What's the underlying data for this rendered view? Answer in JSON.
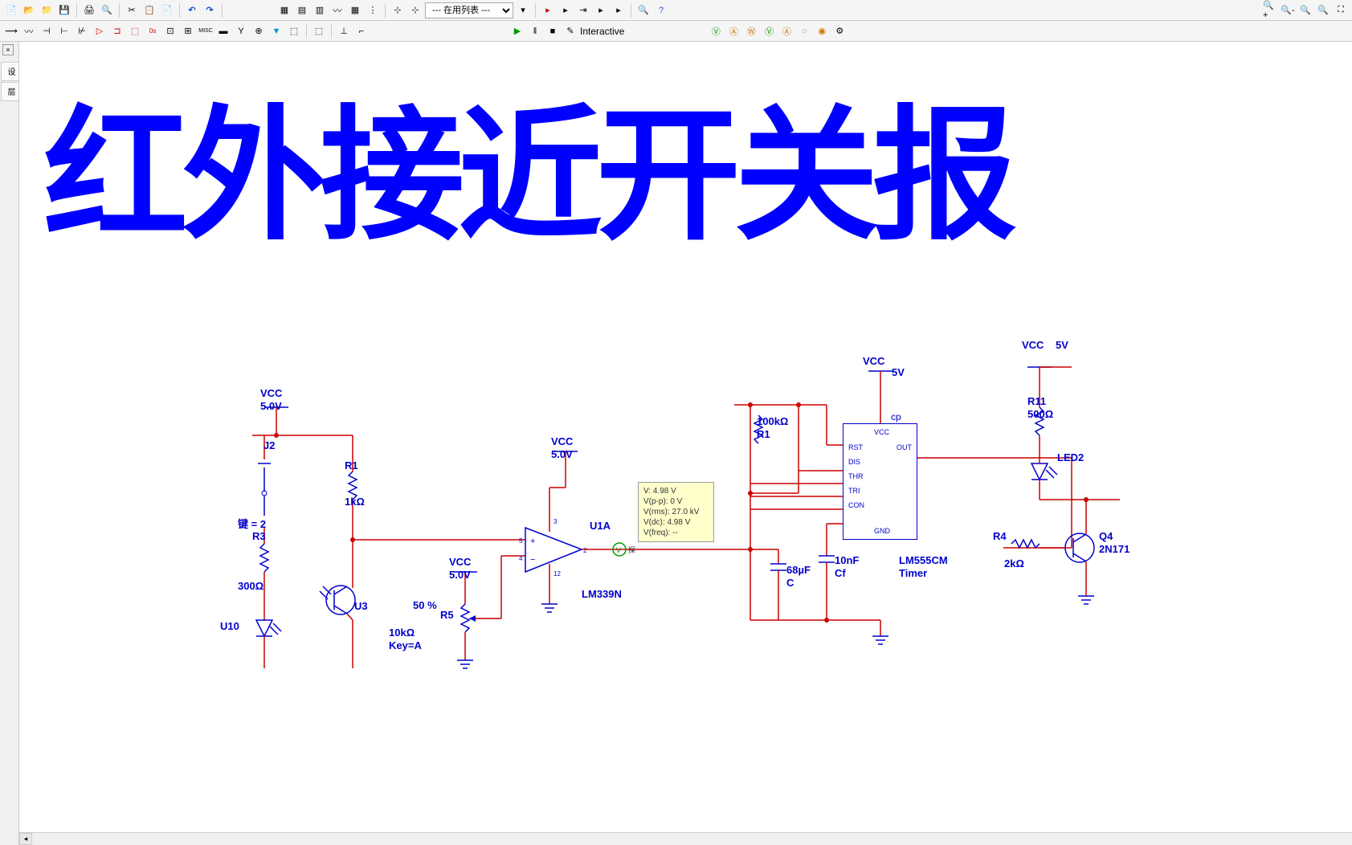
{
  "toolbar": {
    "dropdown_list": "--- 在用列表 ---",
    "interactive_label": "Interactive"
  },
  "title": "红外接近开关报",
  "tooltip": {
    "line1": "V: 4.98 V",
    "line2": "V(p-p): 0 V",
    "line3": "V(rms): 27.0 kV",
    "line4": "V(dc): 4.98 V",
    "line5": "V(freq): --"
  },
  "components": {
    "vcc1": {
      "label": "VCC",
      "value": "5.0V"
    },
    "vcc2": {
      "label": "VCC",
      "value": "5.0V"
    },
    "vcc3": {
      "label": "VCC",
      "value": "5.0V"
    },
    "vcc4": {
      "label": "VCC",
      "value": "5V"
    },
    "vcc5": {
      "label": "VCC",
      "value": "5V"
    },
    "j2": {
      "label": "J2"
    },
    "key2": {
      "label": "键 = 2"
    },
    "r1": {
      "label": "R1",
      "value": "1kΩ"
    },
    "r1b": {
      "label": "R1",
      "value": "100kΩ"
    },
    "r3": {
      "label": "R3",
      "value": "300Ω"
    },
    "r4": {
      "label": "R4",
      "value": "2kΩ"
    },
    "r5": {
      "label": "R5",
      "value": "10kΩ",
      "percent": "50 %",
      "key": "Key=A"
    },
    "r11": {
      "label": "R11",
      "value": "500Ω"
    },
    "u1a": {
      "label": "U1A",
      "value": "LM339N"
    },
    "u3": {
      "label": "U3"
    },
    "u10": {
      "label": "U10"
    },
    "c1": {
      "label": "C",
      "value": "68µF"
    },
    "cf": {
      "label": "Cf",
      "value": "10nF"
    },
    "cp": {
      "label": "cp"
    },
    "timer": {
      "label": "LM555CM",
      "value": "Timer"
    },
    "led2": {
      "label": "LED2"
    },
    "q4": {
      "label": "Q4",
      "value": "2N171"
    },
    "chip_pins": {
      "vcc": "VCC",
      "rst": "RST",
      "out": "OUT",
      "dis": "DIS",
      "thr": "THR",
      "tri": "TRI",
      "con": "CON",
      "gnd": "GND"
    }
  }
}
